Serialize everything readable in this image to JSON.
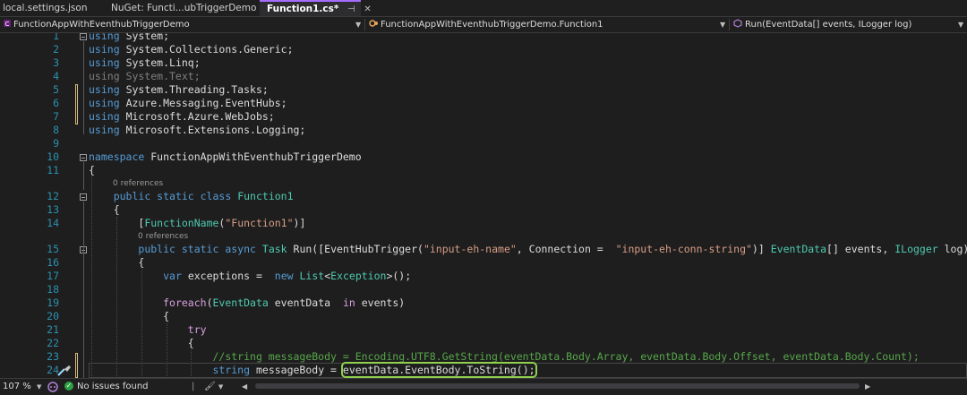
{
  "tabs": [
    {
      "label": "local.settings.json"
    },
    {
      "label": "NuGet: Functi...ubTriggerDemo"
    },
    {
      "label": "Function1.cs*",
      "pin_icon": "⊣",
      "close_icon": "✕"
    }
  ],
  "navbar": {
    "project": "FunctionAppWithEventhubTriggerDemo",
    "class": "FunctionAppWithEventhubTriggerDemo.Function1",
    "member": "Run(EventData[] events, ILogger log)"
  },
  "references": [
    "0 references",
    "0 references"
  ],
  "code": {
    "lines": [
      {
        "n": "1",
        "segs": [
          [
            "kw",
            "using"
          ],
          [
            "",
            "System;"
          ]
        ]
      },
      {
        "n": "2",
        "segs": [
          [
            "kw",
            "using"
          ],
          [
            "",
            "System.Collections.Generic;"
          ]
        ]
      },
      {
        "n": "3",
        "segs": [
          [
            "kw",
            "using"
          ],
          [
            "",
            "System.Linq;"
          ]
        ]
      },
      {
        "n": "4",
        "segs": [
          [
            "dim",
            "using System.Text;"
          ]
        ]
      },
      {
        "n": "5",
        "segs": [
          [
            "kw",
            "using"
          ],
          [
            "",
            "System.Threading.Tasks;"
          ]
        ]
      },
      {
        "n": "6",
        "segs": [
          [
            "kw",
            "using"
          ],
          [
            "",
            "Azure.Messaging.EventHubs;"
          ]
        ]
      },
      {
        "n": "7",
        "segs": [
          [
            "kw",
            "using"
          ],
          [
            "",
            "Microsoft.Azure.WebJobs;"
          ]
        ]
      },
      {
        "n": "8",
        "segs": [
          [
            "kw",
            "using"
          ],
          [
            "",
            "Microsoft.Extensions.Logging;"
          ]
        ]
      },
      {
        "n": "9",
        "segs": []
      },
      {
        "n": "10",
        "segs": [
          [
            "kw",
            "namespace"
          ],
          [
            "",
            "FunctionAppWithEventhubTriggerDemo"
          ]
        ]
      },
      {
        "n": "11",
        "segs": [
          [
            "",
            "{"
          ]
        ]
      },
      {
        "n": "12",
        "segs": [
          [
            "kw",
            "public static class"
          ],
          [
            "ty",
            "Function1"
          ]
        ]
      },
      {
        "n": "13",
        "segs": [
          [
            "",
            "{"
          ]
        ]
      },
      {
        "n": "14",
        "segs": [
          [
            "",
            "["
          ],
          [
            "ty",
            "FunctionName"
          ],
          [
            "",
            "("
          ],
          [
            "st",
            "\"Function1\""
          ],
          [
            "",
            ")]"
          ]
        ]
      },
      {
        "n": "15",
        "segs": [
          [
            "kw",
            "public static async"
          ],
          [
            "ty",
            "Task"
          ],
          [
            "",
            "Run([EventHubTrigger("
          ],
          [
            "st",
            "\"input-eh-name\""
          ],
          [
            "",
            ", Connection = "
          ],
          [
            "st",
            "\"input-eh-conn-string\""
          ],
          [
            "",
            ")]"
          ],
          [
            "ty",
            "EventData"
          ],
          [
            "",
            "[] events,"
          ],
          [
            "ty",
            "ILogger"
          ],
          [
            "",
            "log)"
          ]
        ]
      },
      {
        "n": "16",
        "segs": [
          [
            "",
            "{"
          ]
        ]
      },
      {
        "n": "17",
        "segs": [
          [
            "kw",
            "var"
          ],
          [
            "",
            "exceptions = "
          ],
          [
            "kw",
            "new"
          ],
          [
            "ty",
            "List"
          ],
          [
            "",
            "<"
          ],
          [
            "ty",
            "Exception"
          ],
          [
            "",
            ">();"
          ]
        ]
      },
      {
        "n": "18",
        "segs": []
      },
      {
        "n": "19",
        "segs": [
          [
            "kw2",
            "foreach"
          ],
          [
            "",
            "("
          ],
          [
            "ty",
            "EventData"
          ],
          [
            "",
            "eventData "
          ],
          [
            "kw2",
            "in"
          ],
          [
            "",
            "events)"
          ]
        ]
      },
      {
        "n": "20",
        "segs": [
          [
            "",
            "{"
          ]
        ]
      },
      {
        "n": "21",
        "segs": [
          [
            "kw2",
            "try"
          ]
        ]
      },
      {
        "n": "22",
        "segs": [
          [
            "",
            "{"
          ]
        ]
      },
      {
        "n": "23",
        "segs": [
          [
            "cm",
            "//string messageBody = Encoding.UTF8.GetString(eventData.Body.Array, eventData.Body.Offset, eventData.Body.Count);"
          ]
        ]
      },
      {
        "n": "24",
        "segs": [
          [
            "kw",
            "string"
          ],
          [
            "",
            "messageBody ="
          ],
          [
            "hl",
            "eventData.EventBody.ToString();"
          ]
        ]
      }
    ]
  },
  "status": {
    "zoom": "107 %",
    "issues": "No issues found"
  },
  "colors": {
    "accent": "#a66bff",
    "highlight_box": "#8fd14f",
    "line_number": "#2b91af",
    "keyword": "#569cd6",
    "control_keyword": "#d8a0df",
    "type": "#4ec9b0",
    "string": "#d69d85",
    "comment": "#57a64a"
  }
}
